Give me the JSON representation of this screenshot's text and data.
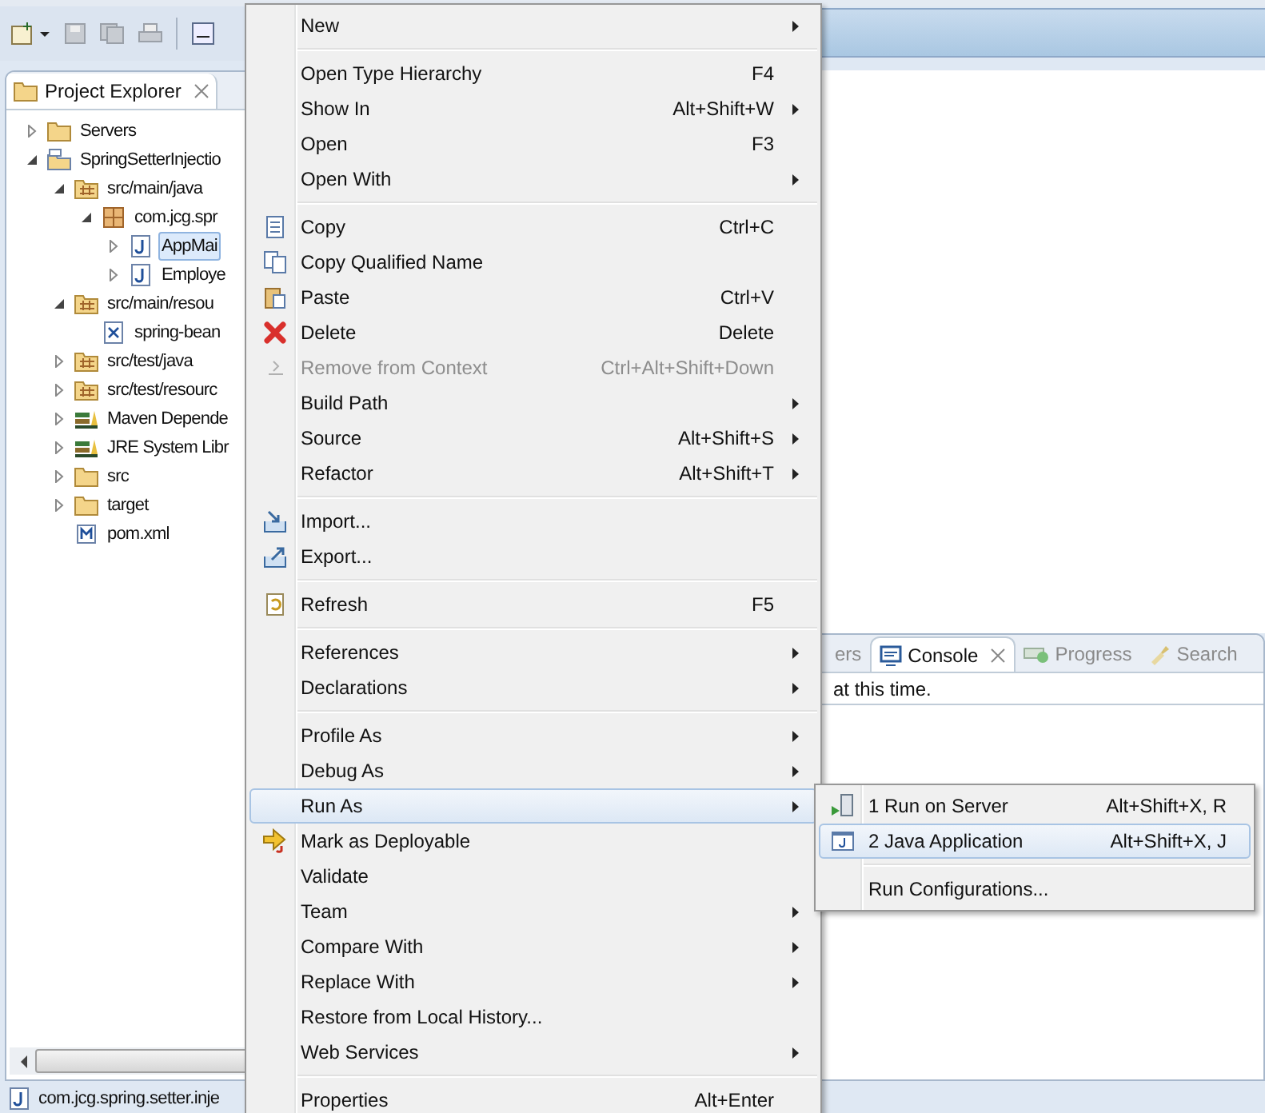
{
  "project_explorer": {
    "title": "Project Explorer",
    "tree": [
      {
        "label": "Servers",
        "kind": "servers",
        "expanded": false,
        "selected": false
      },
      {
        "label": "SpringSetterInjectio",
        "kind": "project",
        "expanded": true,
        "selected": false,
        "children": [
          {
            "label": "src/main/java",
            "kind": "source-folder",
            "expanded": true,
            "selected": false,
            "children": [
              {
                "label": "com.jcg.spr",
                "kind": "package",
                "expanded": true,
                "selected": false,
                "children": [
                  {
                    "label": "AppMai",
                    "kind": "java",
                    "expanded": false,
                    "selected": true
                  },
                  {
                    "label": "Employe",
                    "kind": "java",
                    "expanded": false,
                    "selected": false
                  }
                ]
              }
            ]
          },
          {
            "label": "src/main/resou",
            "kind": "source-folder",
            "expanded": true,
            "selected": false,
            "children": [
              {
                "label": "spring-bean",
                "kind": "xml",
                "selected": false
              }
            ]
          },
          {
            "label": "src/test/java",
            "kind": "source-folder",
            "expanded": false,
            "selected": false
          },
          {
            "label": "src/test/resourc",
            "kind": "source-folder",
            "expanded": false,
            "selected": false
          },
          {
            "label": "Maven Depende",
            "kind": "library",
            "expanded": false,
            "selected": false
          },
          {
            "label": "JRE System Libr",
            "kind": "library",
            "expanded": false,
            "selected": false
          },
          {
            "label": "src",
            "kind": "folder",
            "expanded": false,
            "selected": false
          },
          {
            "label": "target",
            "kind": "folder",
            "expanded": false,
            "selected": false
          },
          {
            "label": "pom.xml",
            "kind": "pom",
            "selected": false
          }
        ]
      }
    ]
  },
  "console_view": {
    "tabs": [
      {
        "label": "ers",
        "kind": "plain",
        "selected": false
      },
      {
        "label": "Console",
        "kind": "console",
        "selected": true
      },
      {
        "label": "Progress",
        "kind": "progress",
        "selected": false
      },
      {
        "label": "Search",
        "kind": "search",
        "selected": false
      }
    ],
    "message": "at this time."
  },
  "status_bar": {
    "text": "com.jcg.spring.setter.inje"
  },
  "context_menu": {
    "groups": [
      [
        {
          "label": "New",
          "submenu": true,
          "disabled": false,
          "selected": false
        }
      ],
      [
        {
          "label": "Open Type Hierarchy",
          "shortcut": "F4",
          "submenu": false,
          "disabled": false,
          "selected": false
        },
        {
          "label": "Show In",
          "shortcut": "Alt+Shift+W",
          "submenu": true,
          "disabled": false,
          "selected": false
        },
        {
          "label": "Open",
          "shortcut": "F3",
          "submenu": false,
          "disabled": false,
          "selected": false
        },
        {
          "label": "Open With",
          "submenu": true,
          "disabled": false,
          "selected": false
        }
      ],
      [
        {
          "label": "Copy",
          "shortcut": "Ctrl+C",
          "kind": "copy",
          "submenu": false,
          "disabled": false,
          "selected": false
        },
        {
          "label": "Copy Qualified Name",
          "kind": "copy-name",
          "submenu": false,
          "disabled": false,
          "selected": false
        },
        {
          "label": "Paste",
          "shortcut": "Ctrl+V",
          "kind": "paste",
          "submenu": false,
          "disabled": false,
          "selected": false
        },
        {
          "label": "Delete",
          "shortcut": "Delete",
          "kind": "delete",
          "submenu": false,
          "disabled": false,
          "selected": false
        },
        {
          "label": "Remove from Context",
          "shortcut": "Ctrl+Alt+Shift+Down",
          "kind": "remove",
          "submenu": false,
          "disabled": true,
          "selected": false
        },
        {
          "label": "Build Path",
          "submenu": true,
          "disabled": false,
          "selected": false
        },
        {
          "label": "Source",
          "shortcut": "Alt+Shift+S",
          "submenu": true,
          "disabled": false,
          "selected": false
        },
        {
          "label": "Refactor",
          "shortcut": "Alt+Shift+T",
          "submenu": true,
          "disabled": false,
          "selected": false
        }
      ],
      [
        {
          "label": "Import...",
          "kind": "import",
          "submenu": false,
          "disabled": false,
          "selected": false
        },
        {
          "label": "Export...",
          "kind": "export",
          "submenu": false,
          "disabled": false,
          "selected": false
        }
      ],
      [
        {
          "label": "Refresh",
          "shortcut": "F5",
          "kind": "refresh",
          "submenu": false,
          "disabled": false,
          "selected": false
        }
      ],
      [
        {
          "label": "References",
          "submenu": true,
          "disabled": false,
          "selected": false
        },
        {
          "label": "Declarations",
          "submenu": true,
          "disabled": false,
          "selected": false
        }
      ],
      [
        {
          "label": "Profile As",
          "submenu": true,
          "disabled": false,
          "selected": false
        },
        {
          "label": "Debug As",
          "submenu": true,
          "disabled": false,
          "selected": false
        },
        {
          "label": "Run As",
          "submenu": true,
          "disabled": false,
          "selected": true
        },
        {
          "label": "Mark as Deployable",
          "kind": "deploy",
          "submenu": false,
          "disabled": false,
          "selected": false
        },
        {
          "label": "Validate",
          "submenu": false,
          "disabled": false,
          "selected": false
        },
        {
          "label": "Team",
          "submenu": true,
          "disabled": false,
          "selected": false
        },
        {
          "label": "Compare With",
          "submenu": true,
          "disabled": false,
          "selected": false
        },
        {
          "label": "Replace With",
          "submenu": true,
          "disabled": false,
          "selected": false
        },
        {
          "label": "Restore from Local History...",
          "submenu": false,
          "disabled": false,
          "selected": false
        },
        {
          "label": "Web Services",
          "submenu": true,
          "disabled": false,
          "selected": false
        }
      ],
      [
        {
          "label": "Properties",
          "shortcut": "Alt+Enter",
          "submenu": false,
          "disabled": false,
          "selected": false
        }
      ]
    ]
  },
  "run_as_submenu": {
    "groups": [
      [
        {
          "label": "1 Run on Server",
          "shortcut": "Alt+Shift+X, R",
          "kind": "server-run",
          "selected": false
        },
        {
          "label": "2 Java Application",
          "shortcut": "Alt+Shift+X, J",
          "kind": "java-app",
          "selected": true
        }
      ],
      [
        {
          "label": "Run Configurations...",
          "selected": false
        }
      ]
    ]
  }
}
